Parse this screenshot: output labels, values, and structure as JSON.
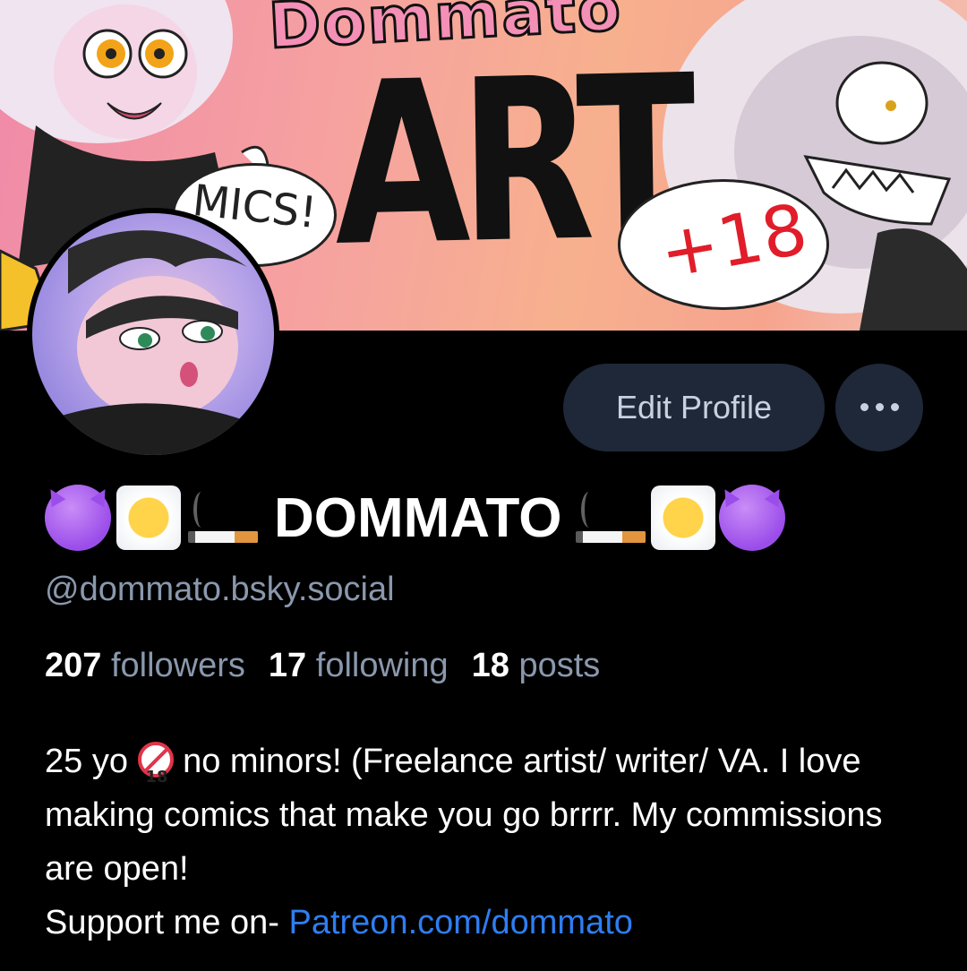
{
  "banner": {
    "title_top": "Dommato",
    "title_main": "ART",
    "bubble_left": "MICS!",
    "bubble_right": "+18"
  },
  "profile": {
    "display_name": "DOMMATO",
    "handle": "@dommato.bsky.social",
    "edit_label": "Edit Profile",
    "more_icon": "ellipsis-icon",
    "name_emojis_left": [
      "smiling-devil-emoji",
      "face-in-clouds-emoji",
      "cigarette-emoji"
    ],
    "name_emojis_right": [
      "cigarette-emoji",
      "face-in-clouds-emoji",
      "smiling-devil-emoji"
    ]
  },
  "stats": {
    "followers_count": "207",
    "followers_label": "followers",
    "following_count": "17",
    "following_label": "following",
    "posts_count": "18",
    "posts_label": "posts"
  },
  "bio": {
    "part1": "25 yo",
    "part2": "no minors! (Freelance artist/ writer/ VA. I love making comics that make you go brrrr. My commissions are open!",
    "part3": "Support me on-",
    "link": "Patreon.com/dommato",
    "no18_badge": "18"
  },
  "colors": {
    "background": "#000000",
    "button_bg": "#1e2838",
    "muted_text": "#8a98ad",
    "link": "#2e7ef2"
  }
}
